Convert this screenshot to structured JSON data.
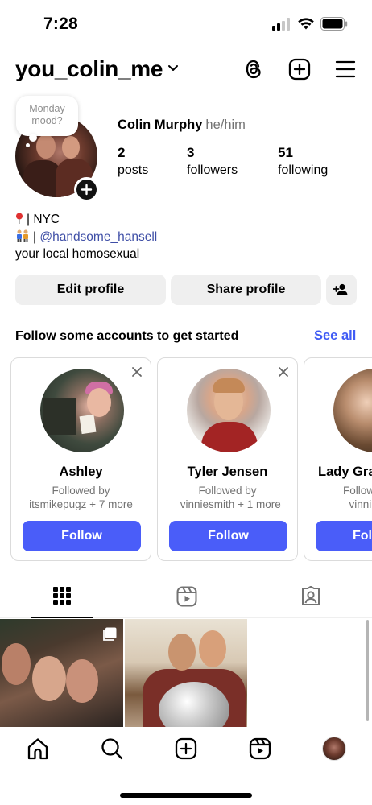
{
  "status_bar": {
    "time": "7:28",
    "icons": [
      "cellular-signal-icon",
      "wifi-icon",
      "battery-icon"
    ]
  },
  "top_bar": {
    "username": "you_colin_me",
    "icons": [
      "chevron-down-icon",
      "threads-icon",
      "create-icon",
      "menu-icon"
    ]
  },
  "note": {
    "line1": "Monday",
    "line2": "mood?"
  },
  "profile": {
    "full_name": "Colin Murphy",
    "pronouns": "he/him",
    "stats": [
      {
        "value": "2",
        "label": "posts"
      },
      {
        "value": "3",
        "label": "followers"
      },
      {
        "value": "51",
        "label": "following"
      }
    ],
    "bio": {
      "line1": "| NYC",
      "line2_prefix": "| ",
      "mention": "@handsome_hansell",
      "line3": "your local homosexual"
    }
  },
  "actions": {
    "edit": "Edit profile",
    "share": "Share profile"
  },
  "suggestions": {
    "title": "Follow some accounts to get started",
    "see_all": "See all",
    "cards": [
      {
        "name": "Ashley",
        "line1": "Followed by",
        "line2": "itsmikepugz + 7 more",
        "button": "Follow"
      },
      {
        "name": "Tyler Jensen",
        "line1": "Followed by",
        "line2": "_vinniesmith + 1 more",
        "button": "Follow"
      },
      {
        "name": "Lady Gra",
        "line1": "Follow",
        "line2": "_vinni",
        "button": "Fol"
      }
    ]
  },
  "tabs": [
    "grid-icon",
    "reels-icon",
    "tagged-icon"
  ],
  "colors": {
    "accent": "#4a5df9",
    "link": "#3f5bf5",
    "mention": "#3e4ea6",
    "button_bg": "#efefef"
  },
  "bottom_nav": [
    "home-icon",
    "search-icon",
    "create-icon",
    "reels-icon",
    "profile-avatar"
  ]
}
